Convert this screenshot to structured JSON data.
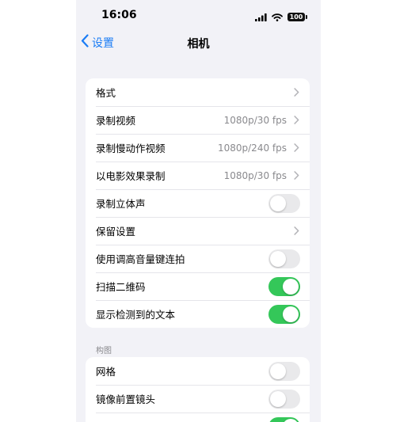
{
  "status_bar": {
    "time": "16:06",
    "battery": "100",
    "icons": [
      "cellular-signal-icon",
      "wifi-icon",
      "battery-icon"
    ]
  },
  "nav": {
    "back_label": "设置",
    "title": "相机"
  },
  "colors": {
    "accent": "#1a7cf5",
    "toggle_on": "#34c759",
    "toggle_off": "#e9e9eb",
    "background": "#f2f2f7"
  },
  "group1": {
    "rows": [
      {
        "label": "格式",
        "value": "",
        "control": "chevron"
      },
      {
        "label": "录制视频",
        "value": "1080p/30 fps",
        "control": "chevron"
      },
      {
        "label": "录制慢动作视频",
        "value": "1080p/240 fps",
        "control": "chevron"
      },
      {
        "label": "以电影效果录制",
        "value": "1080p/30 fps",
        "control": "chevron"
      },
      {
        "label": "录制立体声",
        "value": "",
        "control": "toggle",
        "on": false
      },
      {
        "label": "保留设置",
        "value": "",
        "control": "chevron"
      },
      {
        "label": "使用调高音量键连拍",
        "value": "",
        "control": "toggle",
        "on": false
      },
      {
        "label": "扫描二维码",
        "value": "",
        "control": "toggle",
        "on": true
      },
      {
        "label": "显示检测到的文本",
        "value": "",
        "control": "toggle",
        "on": true
      }
    ]
  },
  "section2": {
    "header": "构图",
    "rows": [
      {
        "label": "网格",
        "control": "toggle",
        "on": false
      },
      {
        "label": "镜像前置镜头",
        "control": "toggle",
        "on": false
      },
      {
        "label": "",
        "control": "toggle",
        "on": true
      }
    ]
  }
}
